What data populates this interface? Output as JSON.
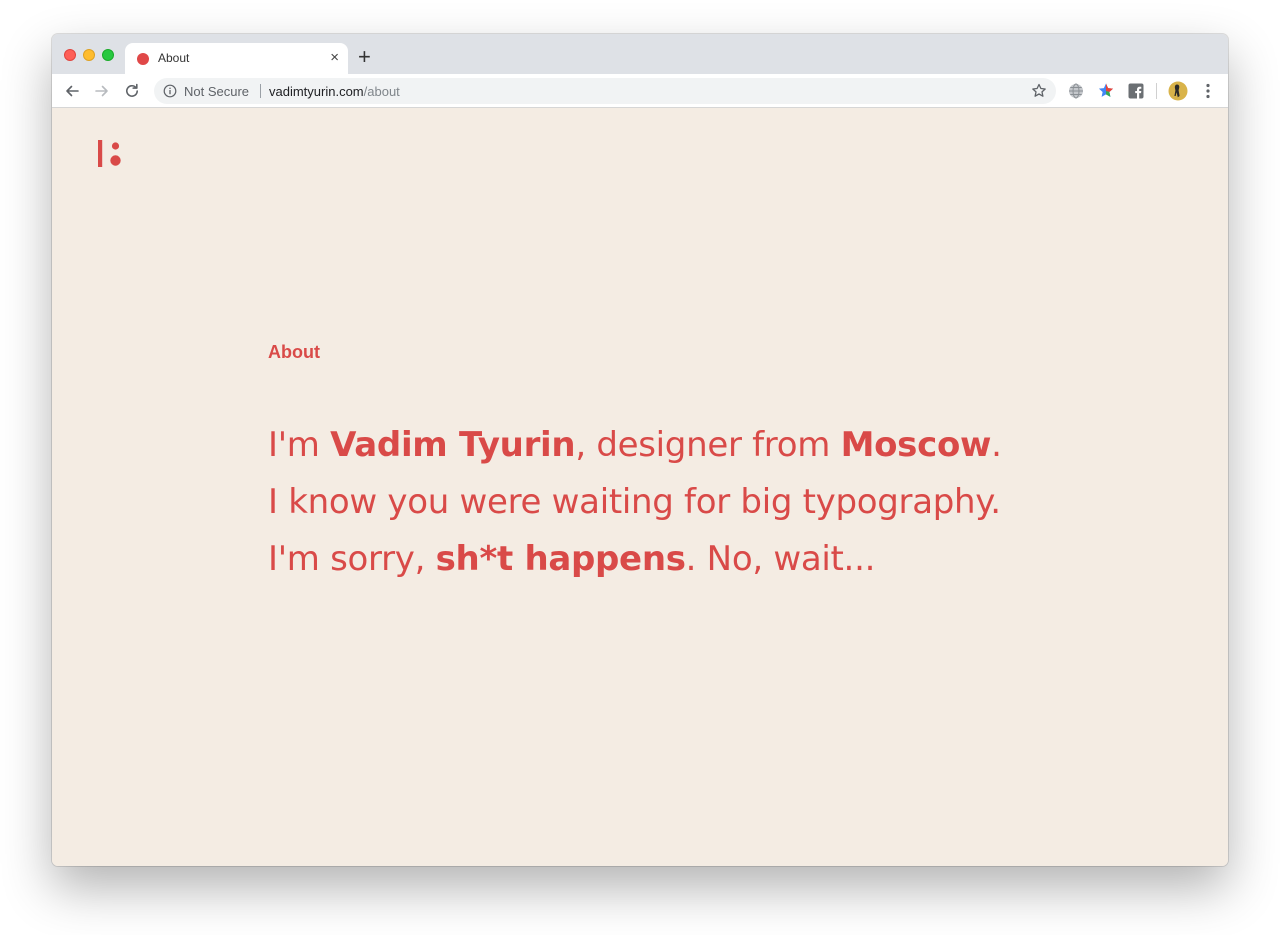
{
  "browser": {
    "tab": {
      "title": "About",
      "favicon_color": "#e04848"
    },
    "new_tab_label": "+",
    "close_tab_label": "×",
    "omnibox": {
      "security_label": "Not Secure",
      "url_host": "vadimtyurin.com",
      "url_path": "/about"
    },
    "extensions": [
      "globe-icon",
      "extension-star-icon",
      "facebook-icon",
      "profile-avatar"
    ]
  },
  "page": {
    "background": "#f4ece3",
    "accent": "#d94a48",
    "section_label": "About",
    "bio": {
      "line1": {
        "t1": "I'm ",
        "b1": "Vadim Tyurin",
        "t2": ", designer from ",
        "b2": "Moscow",
        "t3": "."
      },
      "line2": {
        "t1": "I know you were waiting for big typography."
      },
      "line3": {
        "t1": "I'm sorry, ",
        "b1": "sh*t happens",
        "t2": ". No, wait..."
      }
    }
  }
}
